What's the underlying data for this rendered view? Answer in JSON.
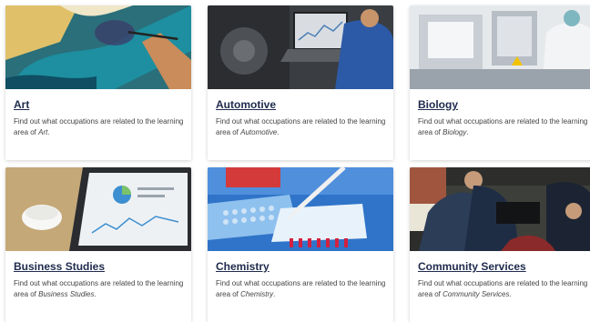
{
  "cards": [
    {
      "title": "Art",
      "desc_prefix": "Find out what occupations are related to the learning area of ",
      "area": "Art",
      "desc_suffix": ".",
      "image": "art-painting-image"
    },
    {
      "title": "Automotive",
      "desc_prefix": "Find out what occupations are related to the learning area of ",
      "area": "Automotive",
      "desc_suffix": ".",
      "image": "automotive-laptop-engine-image"
    },
    {
      "title": "Biology",
      "desc_prefix": "Find out what occupations are related to the learning area of ",
      "area": "Biology",
      "desc_suffix": ".",
      "image": "biology-lab-image"
    },
    {
      "title": "Business Studies",
      "desc_prefix": "Find out what occupations are related to the learning area of ",
      "area": "Business Studies",
      "desc_suffix": ".",
      "image": "business-tablet-charts-image"
    },
    {
      "title": "Chemistry",
      "desc_prefix": "Find out what occupations are related to the learning area of ",
      "area": "Chemistry",
      "desc_suffix": ".",
      "image": "chemistry-pipette-image"
    },
    {
      "title": "Community Services",
      "desc_prefix": "Find out what occupations are related to the learning area of ",
      "area": "Community Services",
      "desc_suffix": ".",
      "image": "community-services-image"
    }
  ],
  "colors": {
    "title": "#1f2b4d",
    "text": "#444444",
    "card_bg": "#ffffff"
  }
}
